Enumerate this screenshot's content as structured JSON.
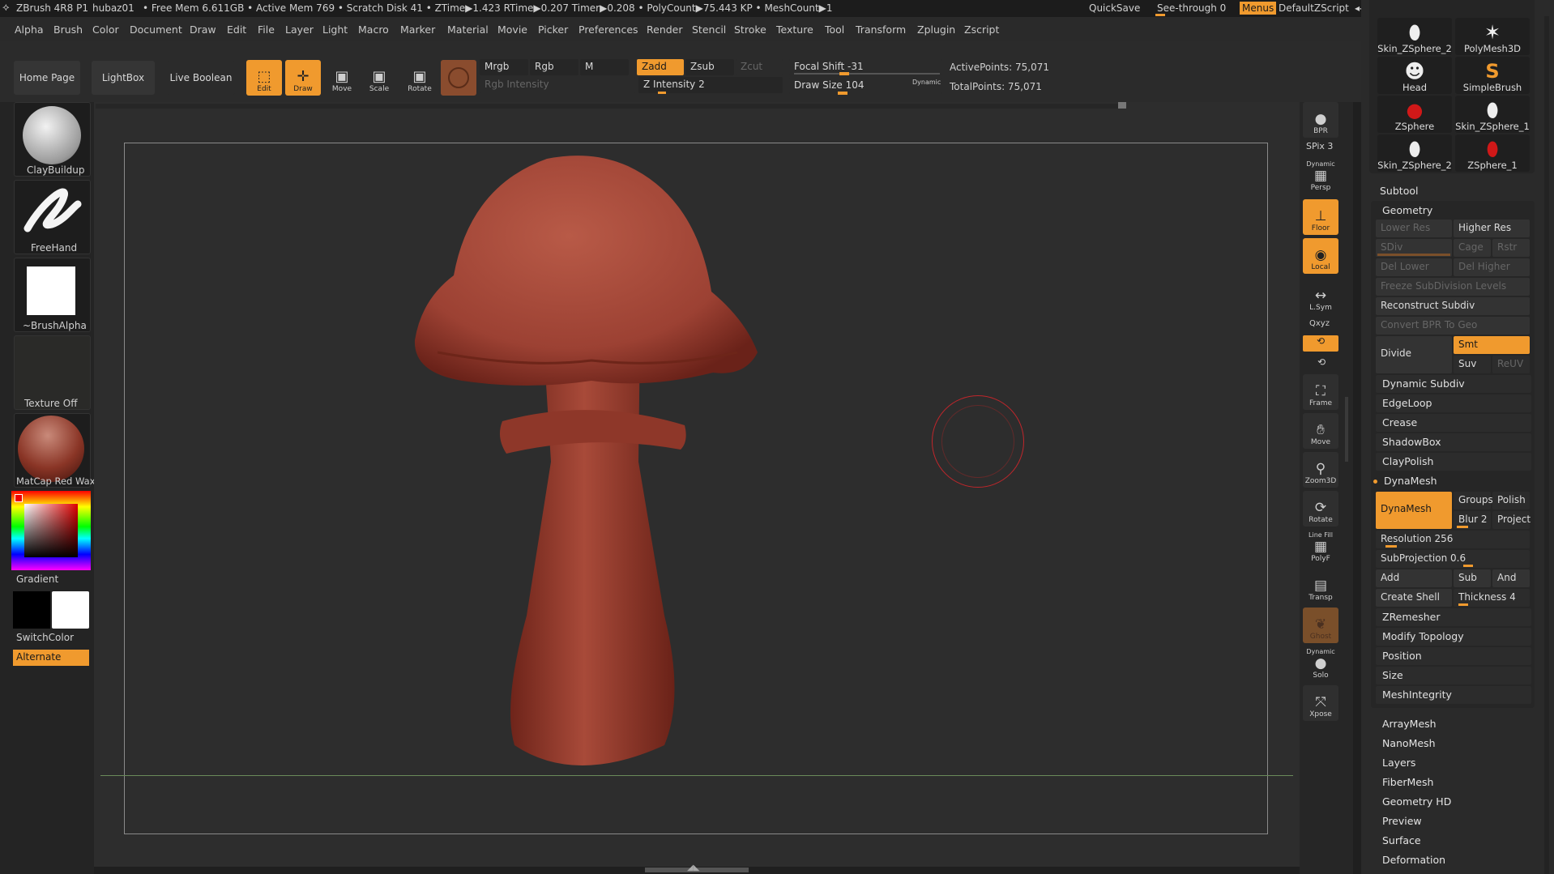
{
  "titlebar": {
    "app": "ZBrush 4R8 P1",
    "user": "hubaz01",
    "stats": "• Free Mem 6.611GB • Active Mem 769 • Scratch Disk 41 • ZTime▶1.423 RTime▶0.207 Timer▶0.208 • PolyCount▶75.443 KP • MeshCount▶1",
    "quicksave": "QuickSave",
    "seethrough": "See-through  0",
    "menus": "Menus",
    "script": "DefaultZScript"
  },
  "menubar": [
    "Alpha",
    "Brush",
    "Color",
    "Document",
    "Draw",
    "Edit",
    "File",
    "Layer",
    "Light",
    "Macro",
    "Marker",
    "Material",
    "Movie",
    "Picker",
    "Preferences",
    "Render",
    "Stencil",
    "Stroke",
    "Texture",
    "Tool",
    "Transform",
    "Zplugin",
    "Zscript"
  ],
  "toptray": {
    "home": "Home Page",
    "lightbox": "LightBox",
    "liveboolean": "Live Boolean",
    "tools": {
      "edit": "Edit",
      "draw": "Draw",
      "move": "Move",
      "scale": "Scale",
      "rotate": "Rotate"
    },
    "mrgb": "Mrgb",
    "rgb": "Rgb",
    "m": "M",
    "rgb_intensity": "Rgb Intensity",
    "zadd": "Zadd",
    "zsub": "Zsub",
    "zcut": "Zcut",
    "z_intensity": "Z Intensity 2",
    "focal_shift": "Focal Shift -31",
    "draw_size": "Draw Size 104",
    "dynamic": "Dynamic",
    "active_points": "ActivePoints: 75,071",
    "total_points": "TotalPoints: 75,071"
  },
  "leftshelf": {
    "brush": "ClayBuildup",
    "stroke": "FreeHand",
    "alpha": "~BrushAlpha",
    "texture": "Texture Off",
    "material": "MatCap Red Wax",
    "gradient": "Gradient",
    "switchcolor": "SwitchColor",
    "alternate": "Alternate"
  },
  "rightshelf": {
    "bpr": "BPR",
    "spix": "SPix 3",
    "dynamic1": "Dynamic",
    "persp": "Persp",
    "floor": "Floor",
    "local": "Local",
    "lsym": "L.Sym",
    "xyz": "Qxyz",
    "frame": "Frame",
    "move": "Move",
    "zoom3d": "Zoom3D",
    "rotate": "Rotate",
    "linefill": "Line Fill",
    "polyf": "PolyF",
    "transp": "Transp",
    "ghost": "Ghost",
    "dynamic2": "Dynamic",
    "solo": "Solo",
    "xpose": "Xpose"
  },
  "tools_grid": [
    {
      "name": "Skin_ZSphere_2",
      "icon": "capsule-icon"
    },
    {
      "name": "PolyMesh3D",
      "icon": "star-icon"
    },
    {
      "name": "Head",
      "icon": "head-icon"
    },
    {
      "name": "SimpleBrush",
      "icon": "s-brush-icon"
    },
    {
      "name": "ZSphere",
      "icon": "red-sphere-icon"
    },
    {
      "name": "Skin_ZSphere_1",
      "icon": "capsule-icon"
    },
    {
      "name": "Skin_ZSphere_2",
      "icon": "capsule-icon"
    },
    {
      "name": "ZSphere_1",
      "icon": "red-sphere-icon"
    }
  ],
  "panel": {
    "subtool": "Subtool",
    "geometry": "Geometry",
    "lower_res": "Lower Res",
    "higher_res": "Higher Res",
    "sdiv": "SDiv",
    "cage": "Cage",
    "rstr": "Rstr",
    "del_lower": "Del Lower",
    "del_higher": "Del Higher",
    "freeze": "Freeze SubDivision Levels",
    "reconstruct": "Reconstruct Subdiv",
    "convert": "Convert BPR To Geo",
    "divide": "Divide",
    "smt": "Smt",
    "suv": "Suv",
    "reuv": "ReUV",
    "dynamic_subdiv": "Dynamic Subdiv",
    "edgeloop": "EdgeLoop",
    "crease": "Crease",
    "shadowbox": "ShadowBox",
    "claypolish": "ClayPolish",
    "dynamesh_header": "DynaMesh",
    "dynamesh_btn": "DynaMesh",
    "groups": "Groups",
    "polish": "Polish",
    "blur": "Blur 2",
    "project": "Project",
    "resolution": "Resolution 256",
    "subprojection": "SubProjection 0.6",
    "add": "Add",
    "sub": "Sub",
    "and": "And",
    "create_shell": "Create Shell",
    "thickness": "Thickness 4",
    "zremesher": "ZRemesher",
    "modify_topology": "Modify Topology",
    "position": "Position",
    "size": "Size",
    "meshintegrity": "MeshIntegrity",
    "sections": [
      "ArrayMesh",
      "NanoMesh",
      "Layers",
      "FiberMesh",
      "Geometry HD",
      "Preview",
      "Surface",
      "Deformation"
    ]
  },
  "colors": {
    "accent": "#f09a2e",
    "mushroom": "#a34535",
    "brush_cursor": "#c0262b"
  }
}
